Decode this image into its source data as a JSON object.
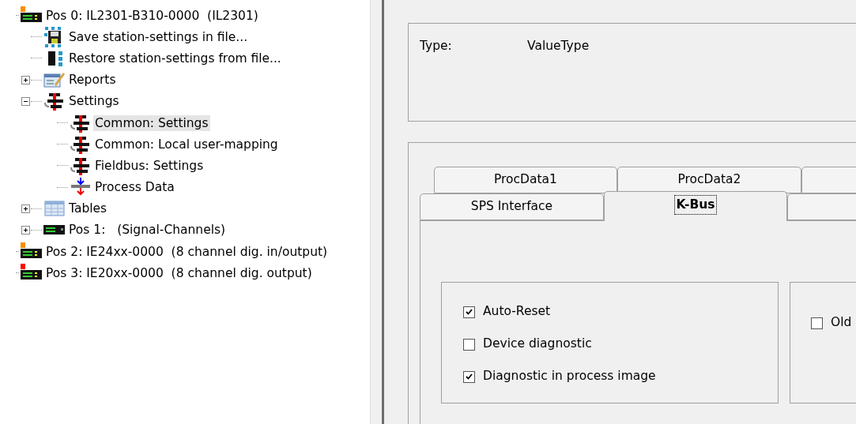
{
  "tree": [
    {
      "label": "Pos 0: IL2301-B310-0000  (IL2301)",
      "kind": "device",
      "color": "#ff8c00",
      "selected": false,
      "children": [
        {
          "label": "Save station-settings in file...",
          "kind": "save",
          "selected": false
        },
        {
          "label": "Restore station-settings from file...",
          "kind": "restore",
          "selected": false
        },
        {
          "label": "Reports",
          "kind": "reports",
          "expanded": false,
          "selected": false
        },
        {
          "label": "Settings",
          "kind": "settings",
          "expanded": true,
          "selected": false,
          "children": [
            {
              "label": "Common: Settings",
              "kind": "settings",
              "selected": true
            },
            {
              "label": "Common: Local user-mapping",
              "kind": "settings",
              "selected": false
            },
            {
              "label": "Fieldbus: Settings",
              "kind": "settings",
              "selected": false
            },
            {
              "label": "Process Data",
              "kind": "process",
              "selected": false
            }
          ]
        },
        {
          "label": "Tables",
          "kind": "tables",
          "expanded": false,
          "selected": false
        },
        {
          "label": "Pos 1:   (Signal-Channels)",
          "kind": "module",
          "expanded": false,
          "selected": false
        }
      ]
    },
    {
      "label": "Pos 2: IE24xx-0000  (8 channel dig. in/output)",
      "kind": "device",
      "color": "#ff8c00",
      "selected": false
    },
    {
      "label": "Pos 3: IE20xx-0000  (8 channel dig. output)",
      "kind": "device",
      "color": "#ff0000",
      "selected": false
    }
  ],
  "info": {
    "label": "Type:",
    "value": "ValueType"
  },
  "tab_rows": [
    [
      {
        "label": "ProcData1",
        "selected": false
      },
      {
        "label": "ProcData2",
        "selected": false
      },
      {
        "selected": false
      }
    ],
    [
      {
        "label": "SPS Interface",
        "selected": false
      },
      {
        "label": "K-Bus",
        "selected": true
      },
      {
        "selected": false
      }
    ]
  ],
  "options": [
    {
      "label": "Auto-Reset",
      "checked": true
    },
    {
      "label": "Device diagnostic",
      "checked": false
    },
    {
      "label": "Diagnostic in process image",
      "checked": true
    }
  ],
  "side_options": [
    {
      "label": "Old",
      "checked": false
    }
  ]
}
